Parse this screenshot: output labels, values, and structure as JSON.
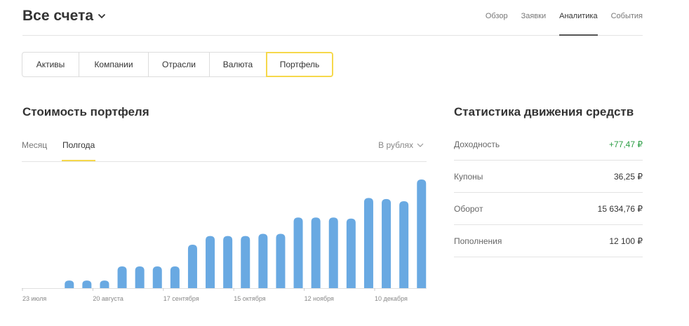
{
  "header": {
    "account_title": "Все счета",
    "nav": [
      {
        "label": "Обзор",
        "active": false
      },
      {
        "label": "Заявки",
        "active": false
      },
      {
        "label": "Аналитика",
        "active": true
      },
      {
        "label": "События",
        "active": false
      }
    ]
  },
  "segments": [
    {
      "label": "Активы",
      "active": false
    },
    {
      "label": "Компании",
      "active": false
    },
    {
      "label": "Отрасли",
      "active": false
    },
    {
      "label": "Валюта",
      "active": false
    },
    {
      "label": "Портфель",
      "active": true
    }
  ],
  "portfolio": {
    "title": "Стоимость портфеля",
    "tabs": [
      {
        "label": "Месяц",
        "active": false
      },
      {
        "label": "Полгода",
        "active": true
      }
    ],
    "currency_select": "В рублях"
  },
  "stats": {
    "title": "Статистика движения средств",
    "rows": [
      {
        "label": "Доходность",
        "value": "+77,47 ₽",
        "positive": true
      },
      {
        "label": "Купоны",
        "value": "36,25 ₽",
        "positive": false
      },
      {
        "label": "Оборот",
        "value": "15 634,76 ₽",
        "positive": false
      },
      {
        "label": "Пополнения",
        "value": "12 100 ₽",
        "positive": false
      }
    ]
  },
  "colors": {
    "accent": "#f6d84b",
    "bar": "#69a9e2",
    "positive": "#2a9d43"
  },
  "icons": {
    "account_chevron": "chevron-down-icon",
    "currency_chevron": "chevron-down-icon"
  },
  "chart_data": {
    "type": "bar",
    "title": "",
    "xlabel": "",
    "ylabel": "",
    "ylim": [
      0,
      100
    ],
    "x_tick_labels": [
      "23 июля",
      "20 августа",
      "17 сентября",
      "15 октября",
      "12 ноября",
      "10 декабря"
    ],
    "values": [
      0,
      0,
      7,
      7,
      7,
      20,
      20,
      20,
      20,
      40,
      48,
      48,
      48,
      50,
      50,
      65,
      65,
      65,
      64,
      83,
      82,
      80,
      100
    ]
  }
}
